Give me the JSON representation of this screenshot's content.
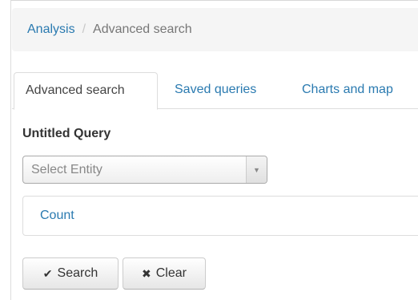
{
  "breadcrumb": {
    "root": "Analysis",
    "separator": "/",
    "current": "Advanced search"
  },
  "tabs": [
    {
      "label": "Advanced search",
      "active": true
    },
    {
      "label": "Saved queries",
      "active": false
    },
    {
      "label": "Charts and map",
      "active": false
    }
  ],
  "query": {
    "title": "Untitled Query",
    "entity_select": {
      "placeholder": "Select Entity",
      "arrow_icon": "chevron-down-icon"
    },
    "count_link": "Count"
  },
  "actions": {
    "search_label": "Search",
    "search_icon": "check-icon",
    "clear_label": "Clear",
    "clear_icon": "x-icon"
  },
  "colors": {
    "link": "#2a7ab0",
    "breadcrumb_bg": "#f5f5f5"
  }
}
